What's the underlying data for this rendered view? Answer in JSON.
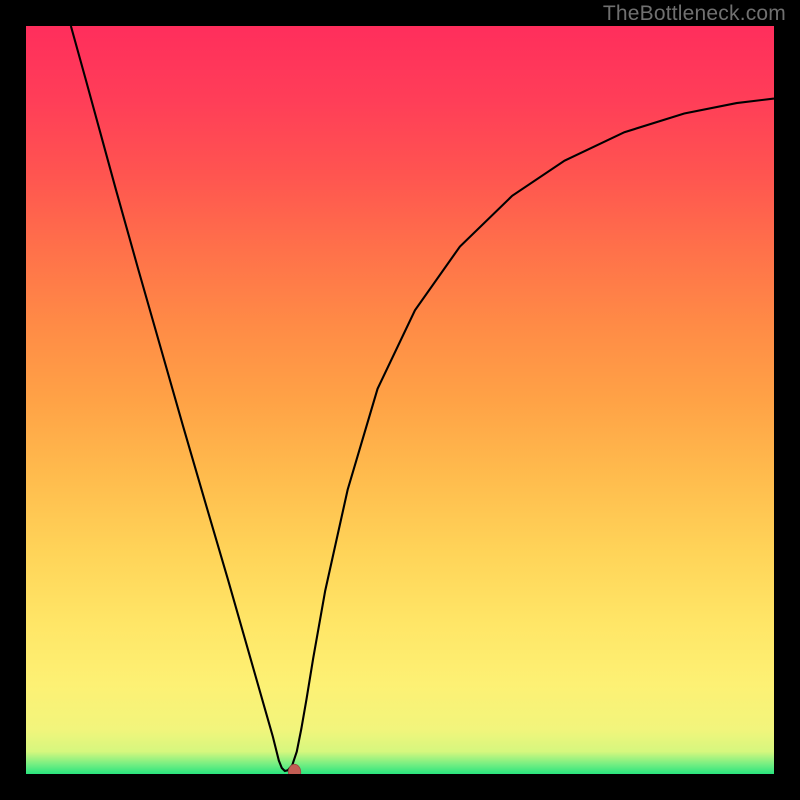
{
  "watermark": "TheBottleneck.com",
  "chart_data": {
    "type": "line",
    "title": "",
    "xlabel": "",
    "ylabel": "",
    "xlim": [
      0,
      100
    ],
    "ylim": [
      0,
      100
    ],
    "grid": false,
    "legend": null,
    "series": [
      {
        "name": "curve",
        "x": [
          6,
          8,
          10,
          12,
          15,
          18,
          21,
          24,
          27,
          30,
          32,
          33,
          33.8,
          34.2,
          34.6,
          35.0,
          35.6,
          36.2,
          36.8,
          37.5,
          38.4,
          40,
          43,
          47,
          52,
          58,
          65,
          72,
          80,
          88,
          95,
          100
        ],
        "values": [
          100,
          92.8,
          85.5,
          78.2,
          67.5,
          57.0,
          46.5,
          36.2,
          26.0,
          15.5,
          8.5,
          5.0,
          1.8,
          0.8,
          0.4,
          0.5,
          1.2,
          3.0,
          6.0,
          10.0,
          15.5,
          24.5,
          38.0,
          51.5,
          62.0,
          70.5,
          77.3,
          82.0,
          85.8,
          88.3,
          89.7,
          90.3
        ]
      }
    ],
    "optimum_marker": {
      "x": 35.9,
      "y": 0.25
    },
    "background_gradient": {
      "bottom_color": "#29e57e",
      "mid_color": "#ffe667",
      "top_color": "#ff2e5c"
    }
  }
}
